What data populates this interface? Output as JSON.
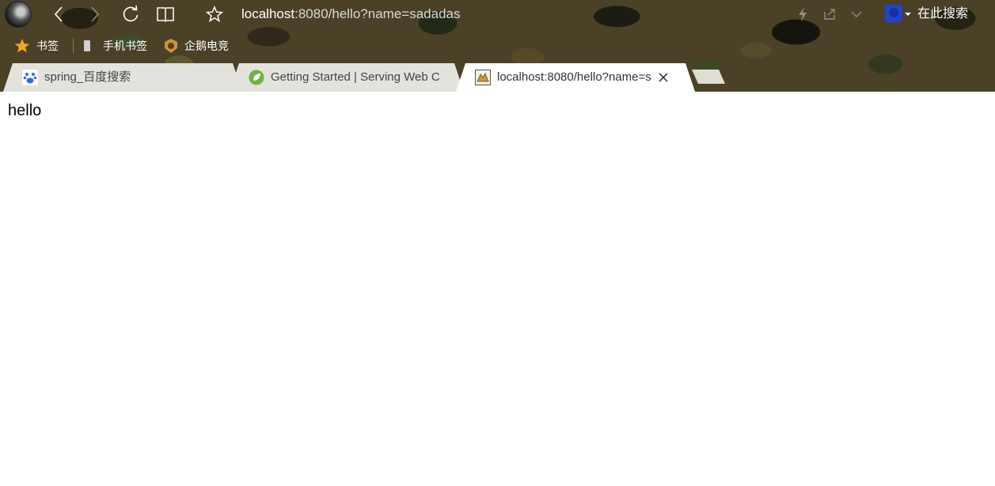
{
  "toolbar": {
    "address_host": "localhost",
    "address_rest": ":8080/hello?name=sadadas",
    "search_label": "在此搜索"
  },
  "bookmarks": {
    "items": [
      {
        "label": "书签",
        "icon": "star-icon"
      },
      {
        "label": "手机书签",
        "icon": "phone-icon"
      },
      {
        "label": "企鹅电竞",
        "icon": "penguin-esports-icon"
      }
    ]
  },
  "tabs": [
    {
      "title": "spring_百度搜索",
      "icon": "baidu-paw-icon",
      "active": false
    },
    {
      "title": "Getting Started | Serving Web C",
      "icon": "spring-leaf-icon",
      "active": false
    },
    {
      "title": "localhost:8080/hello?name=s",
      "icon": "tomcat-icon",
      "active": true
    }
  ],
  "page": {
    "body_text": "hello"
  },
  "colors": {
    "tab_inactive": "#e4e2dd",
    "tab_active": "#ffffff",
    "chrome_text": "#ffffff",
    "search_engine": "#2244cc"
  }
}
